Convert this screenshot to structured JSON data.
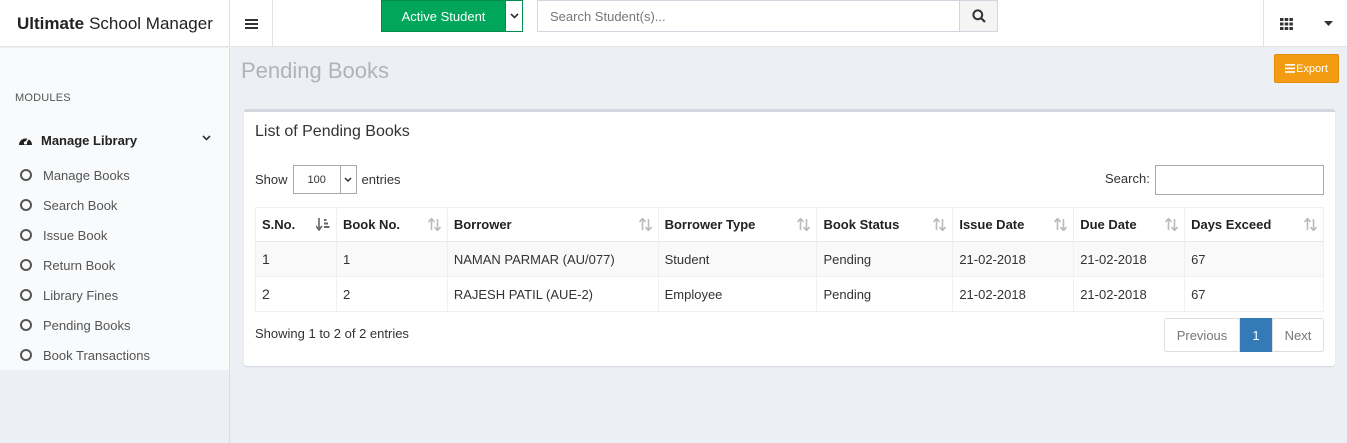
{
  "brand": {
    "bold": "Ultimate",
    "rest": "School Manager"
  },
  "header": {
    "active_student_label": "Active Student",
    "search_placeholder": "Search Student(s)..."
  },
  "sidebar": {
    "section_label": "MODULES",
    "group_label": "Manage Library",
    "items": [
      {
        "label": "Manage Books"
      },
      {
        "label": "Search Book"
      },
      {
        "label": "Issue Book"
      },
      {
        "label": "Return Book"
      },
      {
        "label": "Library Fines"
      },
      {
        "label": "Pending Books"
      },
      {
        "label": "Book Transactions"
      }
    ]
  },
  "page": {
    "title": "Pending Books",
    "export_label": "Export",
    "box_title": "List of Pending Books",
    "show_label": "Show",
    "entries_value": "100",
    "entries_label": "entries",
    "search_label": "Search:",
    "info": "Showing 1 to 2 of 2 entries",
    "pager": {
      "prev": "Previous",
      "current": "1",
      "next": "Next"
    }
  },
  "table": {
    "columns": [
      "S.No.",
      "Book No.",
      "Borrower",
      "Borrower Type",
      "Book Status",
      "Issue Date",
      "Due Date",
      "Days Exceed"
    ],
    "rows": [
      [
        "1",
        "1",
        "NAMAN PARMAR (AU/077)",
        "Student",
        "Pending",
        "21-02-2018",
        "21-02-2018",
        "67"
      ],
      [
        "2",
        "2",
        "RAJESH PATIL (AUE-2)",
        "Employee",
        "Pending",
        "21-02-2018",
        "21-02-2018",
        "67"
      ]
    ]
  },
  "colors": {
    "green": "#00a65a",
    "orange": "#f39c12",
    "blue": "#337ab7"
  }
}
